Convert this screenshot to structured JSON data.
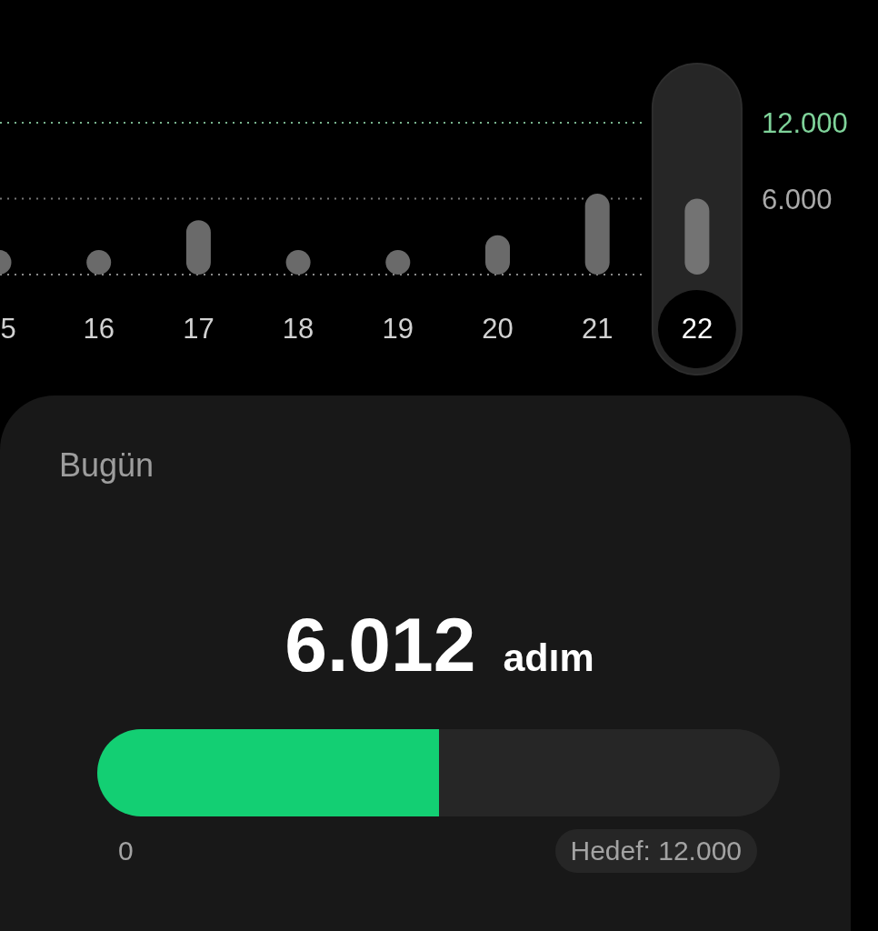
{
  "chart": {
    "day_columns": [
      {
        "selected": false
      },
      {
        "selected": false
      },
      {
        "selected": false
      },
      {
        "selected": false
      },
      {
        "selected": false
      },
      {
        "selected": false
      },
      {
        "selected": false
      },
      {
        "selected": true
      }
    ],
    "chart_data": {
      "type": "bar",
      "categories": [
        "5",
        "16",
        "17",
        "18",
        "19",
        "20",
        "21",
        "22"
      ],
      "values": [
        1900,
        1900,
        4300,
        1900,
        1900,
        3100,
        6400,
        6000
      ],
      "ylim": [
        0,
        12000
      ],
      "yticks": [
        {
          "value": 6000,
          "label": "6.000"
        },
        {
          "value": 12000,
          "label": "12.000"
        }
      ]
    }
  },
  "today": {
    "title": "Bugün",
    "steps": "6.012",
    "unit": "adım",
    "progress": {
      "level": 0.5,
      "start_label": "0",
      "goal_label": "Hedef: 12.000"
    }
  }
}
